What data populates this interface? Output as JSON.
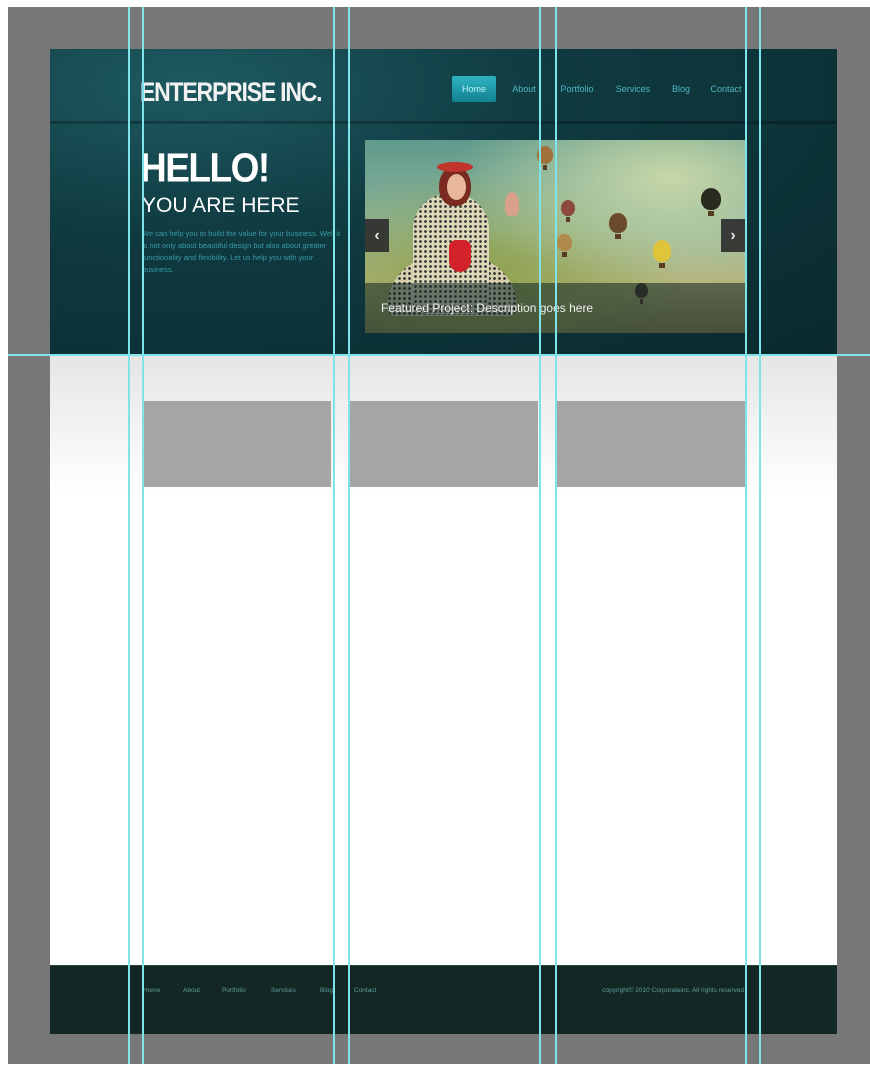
{
  "site": {
    "logo": "ENTERPRISE INC."
  },
  "nav": {
    "items": [
      {
        "label": "Home",
        "active": true
      },
      {
        "label": "About",
        "active": false
      },
      {
        "label": "Portfolio",
        "active": false
      },
      {
        "label": "Services",
        "active": false
      },
      {
        "label": "Blog",
        "active": false
      },
      {
        "label": "Contact",
        "active": false
      }
    ]
  },
  "hero": {
    "heading": "HELLO!",
    "subheading": "YOU ARE HERE",
    "intro": "We can help you to build the value for your business. Well it is not only about beautiful design but also about greater functionality and flexibility. Let us help you with your business."
  },
  "slider": {
    "caption": "Featured Project: Description goes here",
    "prev_icon": "‹",
    "next_icon": "›"
  },
  "footer": {
    "links": [
      "Home",
      "About",
      "Portfolio",
      "Services",
      "Blog",
      "Contact"
    ],
    "copyright": "copyright© 2010 Corporateinc. All rights reserved"
  },
  "colors": {
    "header_bg": "#0f3a40",
    "accent": "#2fb3c3",
    "footer_bg": "#132825",
    "placeholder_box": "#a5a5a5",
    "guide": "#7fe3ea"
  }
}
